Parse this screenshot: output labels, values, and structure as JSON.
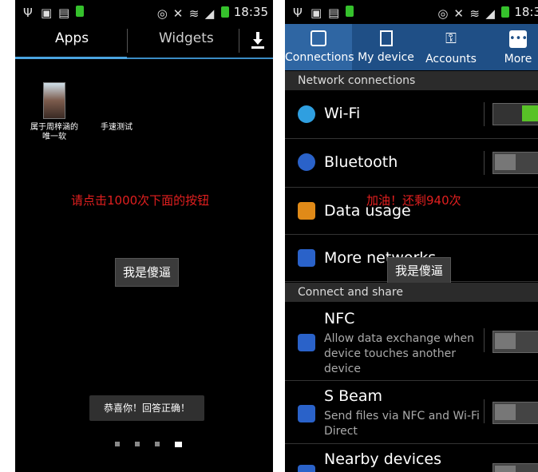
{
  "left": {
    "status": {
      "time": "18:35"
    },
    "tabs": {
      "apps": "Apps",
      "widgets": "Widgets"
    },
    "apps": [
      {
        "label": "属于周梓涵的\n唯一软"
      },
      {
        "label": "手速测试"
      }
    ],
    "instruction": "请点击1000次下面的按钮",
    "button_label": "我是傻逼",
    "toast": "恭喜你！回答正确！"
  },
  "right": {
    "status": {
      "time": "18:3"
    },
    "tabs": [
      {
        "label": "Connections"
      },
      {
        "label": "My device"
      },
      {
        "label": "Accounts"
      },
      {
        "label": "More"
      }
    ],
    "sections": {
      "network": "Network connections",
      "connect": "Connect and share"
    },
    "items": {
      "wifi": "Wi-Fi",
      "bluetooth": "Bluetooth",
      "data_usage": "Data usage",
      "more_networks": "More networks",
      "nfc_title": "NFC",
      "nfc_sub": "Allow data exchange when device touches another device",
      "sbeam_title": "S Beam",
      "sbeam_sub": "Send files via NFC and Wi-Fi Direct",
      "nearby": "Nearby devices"
    },
    "overlay_text": "加油！还剩940次",
    "overlay_button": "我是傻逼"
  },
  "colors": {
    "accent": "#4aa4e0",
    "red": "#e21f1f",
    "on": "#58c227"
  }
}
